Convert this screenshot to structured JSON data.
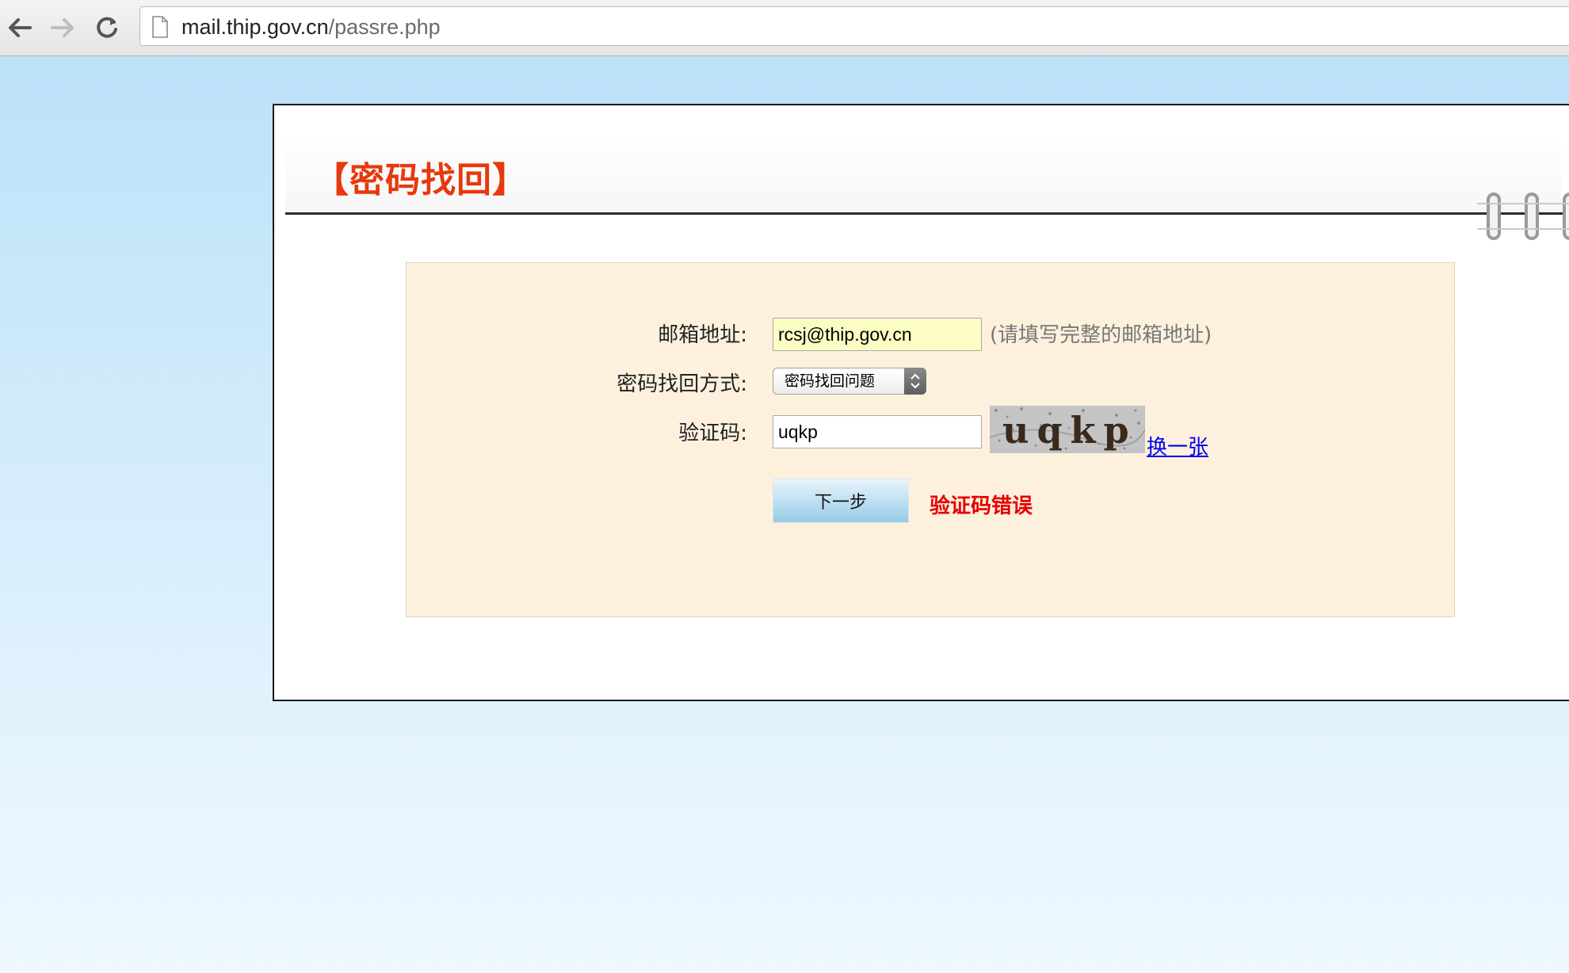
{
  "browser": {
    "url_host": "mail.thip.gov.cn",
    "url_path": "/passre.php"
  },
  "page": {
    "title": "【密码找回】"
  },
  "form": {
    "email_label": "邮箱地址:",
    "email_value": "rcsj@thip.gov.cn",
    "email_hint": "(请填写完整的邮箱地址)",
    "method_label": "密码找回方式:",
    "method_selected": "密码找回问题",
    "captcha_label": "验证码:",
    "captcha_value": "uqkp",
    "captcha_image_text": "uqkp",
    "refresh_link": "换一张",
    "next_button": "下一步",
    "error_message": "验证码错误"
  }
}
